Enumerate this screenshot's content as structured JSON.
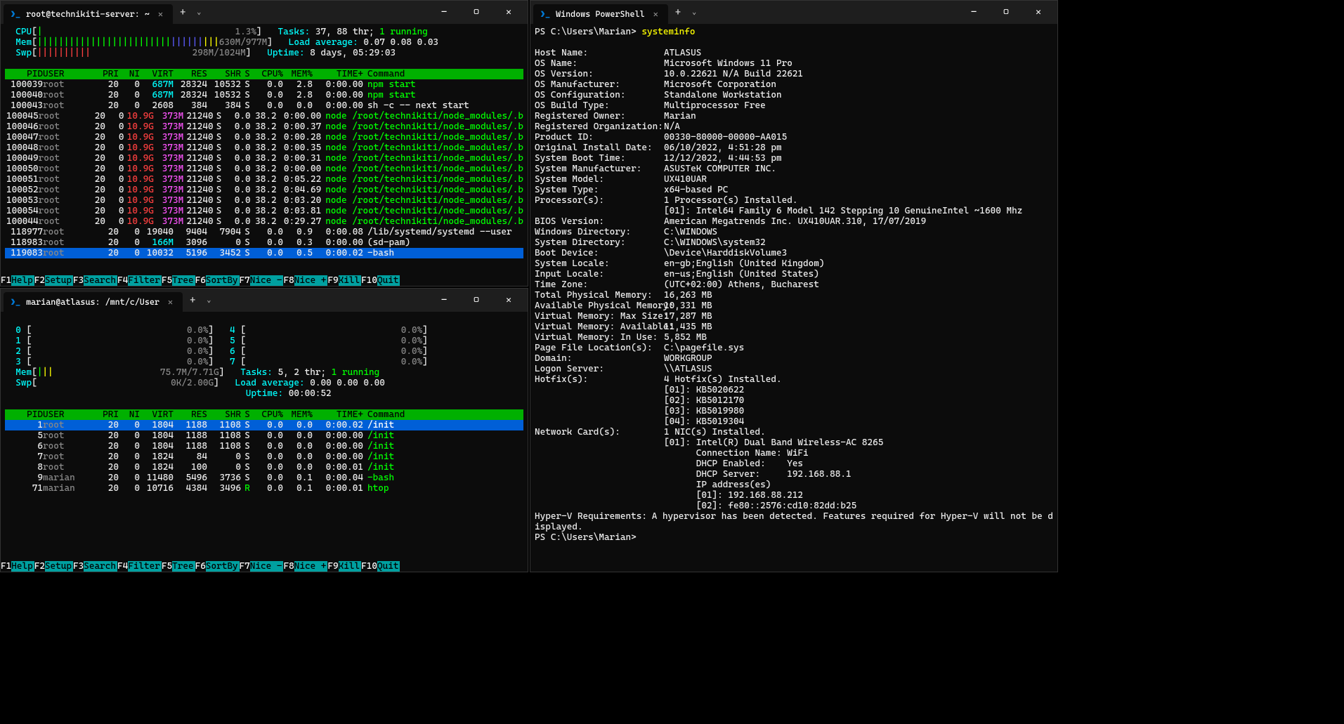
{
  "panes": {
    "topleft": {
      "title": "root@technikiti-server: ~"
    },
    "botleft": {
      "title": "marian@atlasus: /mnt/c/User"
    },
    "right": {
      "title": "Windows PowerShell"
    }
  },
  "htop1": {
    "cpu_pct": "1.3%",
    "mem_used": "630M",
    "mem_total": "977M",
    "swp_used": "298M",
    "swp_total": "1024M",
    "tasks": "37",
    "threads": "88",
    "running": "1",
    "load": "0.07 0.08 0.03",
    "uptime": "8 days, 05:29:03",
    "header": [
      "PID",
      "USER",
      "PRI",
      "NI",
      "VIRT",
      "RES",
      "SHR",
      "S",
      "CPU%",
      "MEM%",
      "TIME+",
      "Command"
    ],
    "rows": [
      {
        "pid": "100039",
        "user": "root",
        "pri": "20",
        "ni": "0",
        "virt": "687M",
        "res": "28324",
        "shr": "10532",
        "s": "S",
        "cpu": "0.0",
        "mem": "2.8",
        "time": "0:00.00",
        "cmd": "npm start",
        "vc": "cy",
        "cc": "gn"
      },
      {
        "pid": "100040",
        "user": "root",
        "pri": "20",
        "ni": "0",
        "virt": "687M",
        "res": "28324",
        "shr": "10532",
        "s": "S",
        "cpu": "0.0",
        "mem": "2.8",
        "time": "0:00.00",
        "cmd": "npm start",
        "vc": "cy",
        "cc": "gn"
      },
      {
        "pid": "100043",
        "user": "root",
        "pri": "20",
        "ni": "0",
        "virt": "2608",
        "res": "384",
        "shr": "384",
        "s": "S",
        "cpu": "0.0",
        "mem": "0.0",
        "time": "0:00.00",
        "cmd": "sh -c -- next start",
        "vc": "wh",
        "cc": "wh"
      },
      {
        "pid": "100045",
        "user": "root",
        "pri": "20",
        "ni": "0",
        "virt": "10.9G",
        "res": "373M",
        "shr": "21240",
        "s": "S",
        "cpu": "0.0",
        "mem": "38.2",
        "time": "0:00.00",
        "cmd": "node /root/technikiti/node_modules/.b",
        "vc": "rd",
        "rc": "mg",
        "cc": "gn"
      },
      {
        "pid": "100046",
        "user": "root",
        "pri": "20",
        "ni": "0",
        "virt": "10.9G",
        "res": "373M",
        "shr": "21240",
        "s": "S",
        "cpu": "0.0",
        "mem": "38.2",
        "time": "0:00.37",
        "cmd": "node /root/technikiti/node_modules/.b",
        "vc": "rd",
        "rc": "mg",
        "cc": "gn"
      },
      {
        "pid": "100047",
        "user": "root",
        "pri": "20",
        "ni": "0",
        "virt": "10.9G",
        "res": "373M",
        "shr": "21240",
        "s": "S",
        "cpu": "0.0",
        "mem": "38.2",
        "time": "0:00.28",
        "cmd": "node /root/technikiti/node_modules/.b",
        "vc": "rd",
        "rc": "mg",
        "cc": "gn"
      },
      {
        "pid": "100048",
        "user": "root",
        "pri": "20",
        "ni": "0",
        "virt": "10.9G",
        "res": "373M",
        "shr": "21240",
        "s": "S",
        "cpu": "0.0",
        "mem": "38.2",
        "time": "0:00.35",
        "cmd": "node /root/technikiti/node_modules/.b",
        "vc": "rd",
        "rc": "mg",
        "cc": "gn"
      },
      {
        "pid": "100049",
        "user": "root",
        "pri": "20",
        "ni": "0",
        "virt": "10.9G",
        "res": "373M",
        "shr": "21240",
        "s": "S",
        "cpu": "0.0",
        "mem": "38.2",
        "time": "0:00.31",
        "cmd": "node /root/technikiti/node_modules/.b",
        "vc": "rd",
        "rc": "mg",
        "cc": "gn"
      },
      {
        "pid": "100050",
        "user": "root",
        "pri": "20",
        "ni": "0",
        "virt": "10.9G",
        "res": "373M",
        "shr": "21240",
        "s": "S",
        "cpu": "0.0",
        "mem": "38.2",
        "time": "0:00.00",
        "cmd": "node /root/technikiti/node_modules/.b",
        "vc": "rd",
        "rc": "mg",
        "cc": "gn"
      },
      {
        "pid": "100051",
        "user": "root",
        "pri": "20",
        "ni": "0",
        "virt": "10.9G",
        "res": "373M",
        "shr": "21240",
        "s": "S",
        "cpu": "0.0",
        "mem": "38.2",
        "time": "0:05.22",
        "cmd": "node /root/technikiti/node_modules/.b",
        "vc": "rd",
        "rc": "mg",
        "cc": "gn"
      },
      {
        "pid": "100052",
        "user": "root",
        "pri": "20",
        "ni": "0",
        "virt": "10.9G",
        "res": "373M",
        "shr": "21240",
        "s": "S",
        "cpu": "0.0",
        "mem": "38.2",
        "time": "0:04.69",
        "cmd": "node /root/technikiti/node_modules/.b",
        "vc": "rd",
        "rc": "mg",
        "cc": "gn"
      },
      {
        "pid": "100053",
        "user": "root",
        "pri": "20",
        "ni": "0",
        "virt": "10.9G",
        "res": "373M",
        "shr": "21240",
        "s": "S",
        "cpu": "0.0",
        "mem": "38.2",
        "time": "0:03.20",
        "cmd": "node /root/technikiti/node_modules/.b",
        "vc": "rd",
        "rc": "mg",
        "cc": "gn"
      },
      {
        "pid": "100054",
        "user": "root",
        "pri": "20",
        "ni": "0",
        "virt": "10.9G",
        "res": "373M",
        "shr": "21240",
        "s": "S",
        "cpu": "0.0",
        "mem": "38.2",
        "time": "0:03.81",
        "cmd": "node /root/technikiti/node_modules/.b",
        "vc": "rd",
        "rc": "mg",
        "cc": "gn"
      },
      {
        "pid": "100044",
        "user": "root",
        "pri": "20",
        "ni": "0",
        "virt": "10.9G",
        "res": "373M",
        "shr": "21240",
        "s": "S",
        "cpu": "0.0",
        "mem": "38.2",
        "time": "0:29.27",
        "cmd": "node /root/technikiti/node_modules/.b",
        "vc": "rd",
        "rc": "mg",
        "cc": "gn"
      },
      {
        "pid": "118977",
        "user": "root",
        "pri": "20",
        "ni": "0",
        "virt": "19040",
        "res": "9404",
        "shr": "7904",
        "s": "S",
        "cpu": "0.0",
        "mem": "0.9",
        "time": "0:00.08",
        "cmd": "/lib/systemd/systemd --user",
        "vc": "wh",
        "cc": "wh"
      },
      {
        "pid": "118983",
        "user": "root",
        "pri": "20",
        "ni": "0",
        "virt": "166M",
        "res": "3096",
        "shr": "0",
        "s": "S",
        "cpu": "0.0",
        "mem": "0.3",
        "time": "0:00.00",
        "cmd": "(sd-pam)",
        "vc": "cy",
        "cc": "wh"
      },
      {
        "pid": "119083",
        "user": "root",
        "pri": "20",
        "ni": "0",
        "virt": "10032",
        "res": "5196",
        "shr": "3452",
        "s": "S",
        "cpu": "0.0",
        "mem": "0.5",
        "time": "0:00.02",
        "cmd": "-bash",
        "vc": "wh",
        "cc": "wh",
        "sel": true
      }
    ],
    "fkeys": [
      [
        "F1",
        "Help"
      ],
      [
        "F2",
        "Setup"
      ],
      [
        "F3",
        "Search"
      ],
      [
        "F4",
        "Filter"
      ],
      [
        "F5",
        "Tree"
      ],
      [
        "F6",
        "SortBy"
      ],
      [
        "F7",
        "Nice -"
      ],
      [
        "F8",
        "Nice +"
      ],
      [
        "F9",
        "Kill"
      ],
      [
        "F10",
        "Quit"
      ]
    ]
  },
  "htop2": {
    "cores": [
      {
        "n": "0",
        "pct": "0.0%"
      },
      {
        "n": "1",
        "pct": "0.0%"
      },
      {
        "n": "2",
        "pct": "0.0%"
      },
      {
        "n": "3",
        "pct": "0.0%"
      },
      {
        "n": "4",
        "pct": "0.0%"
      },
      {
        "n": "5",
        "pct": "0.0%"
      },
      {
        "n": "6",
        "pct": "0.0%"
      },
      {
        "n": "7",
        "pct": "0.0%"
      }
    ],
    "mem_used": "75.7M",
    "mem_total": "7.71G",
    "swp_used": "0K",
    "swp_total": "2.00G",
    "tasks": "5",
    "threads": "2",
    "running": "1",
    "load": "0.00 0.00 0.00",
    "uptime": "00:00:52",
    "rows": [
      {
        "pid": "1",
        "user": "root",
        "pri": "20",
        "ni": "0",
        "virt": "1804",
        "res": "1188",
        "shr": "1108",
        "s": "S",
        "cpu": "0.0",
        "mem": "0.0",
        "time": "0:00.02",
        "cmd": "/init",
        "sel": true
      },
      {
        "pid": "5",
        "user": "root",
        "pri": "20",
        "ni": "0",
        "virt": "1804",
        "res": "1188",
        "shr": "1108",
        "s": "S",
        "cpu": "0.0",
        "mem": "0.0",
        "time": "0:00.00",
        "cmd": "/init"
      },
      {
        "pid": "6",
        "user": "root",
        "pri": "20",
        "ni": "0",
        "virt": "1804",
        "res": "1188",
        "shr": "1108",
        "s": "S",
        "cpu": "0.0",
        "mem": "0.0",
        "time": "0:00.00",
        "cmd": "/init"
      },
      {
        "pid": "7",
        "user": "root",
        "pri": "20",
        "ni": "0",
        "virt": "1824",
        "res": "84",
        "shr": "0",
        "s": "S",
        "cpu": "0.0",
        "mem": "0.0",
        "time": "0:00.00",
        "cmd": "/init"
      },
      {
        "pid": "8",
        "user": "root",
        "pri": "20",
        "ni": "0",
        "virt": "1824",
        "res": "100",
        "shr": "0",
        "s": "S",
        "cpu": "0.0",
        "mem": "0.0",
        "time": "0:00.01",
        "cmd": "/init"
      },
      {
        "pid": "9",
        "user": "marian",
        "pri": "20",
        "ni": "0",
        "virt": "11480",
        "res": "5496",
        "shr": "3736",
        "s": "S",
        "cpu": "0.0",
        "mem": "0.1",
        "time": "0:00.04",
        "cmd": "-bash"
      },
      {
        "pid": "71",
        "user": "marian",
        "pri": "20",
        "ni": "0",
        "virt": "10716",
        "res": "4384",
        "shr": "3496",
        "s": "R",
        "cpu": "0.0",
        "mem": "0.1",
        "time": "0:00.01",
        "cmd": "htop"
      }
    ]
  },
  "ps": {
    "prompt": "PS C:\\Users\\Marian>",
    "cmd": "systeminfo",
    "lines": [
      [
        "Host Name:",
        "ATLASUS"
      ],
      [
        "OS Name:",
        "Microsoft Windows 11 Pro"
      ],
      [
        "OS Version:",
        "10.0.22621 N/A Build 22621"
      ],
      [
        "OS Manufacturer:",
        "Microsoft Corporation"
      ],
      [
        "OS Configuration:",
        "Standalone Workstation"
      ],
      [
        "OS Build Type:",
        "Multiprocessor Free"
      ],
      [
        "Registered Owner:",
        "Marian"
      ],
      [
        "Registered Organization:",
        "N/A"
      ],
      [
        "Product ID:",
        "00330-80000-00000-AA015"
      ],
      [
        "Original Install Date:",
        "06/10/2022, 4:51:28 pm"
      ],
      [
        "System Boot Time:",
        "12/12/2022, 4:44:53 pm"
      ],
      [
        "System Manufacturer:",
        "ASUSTeK COMPUTER INC."
      ],
      [
        "System Model:",
        "UX410UAR"
      ],
      [
        "System Type:",
        "x64-based PC"
      ],
      [
        "Processor(s):",
        "1 Processor(s) Installed."
      ],
      [
        "",
        "[01]: Intel64 Family 6 Model 142 Stepping 10 GenuineIntel ~1600 Mhz"
      ],
      [
        "BIOS Version:",
        "American Megatrends Inc. UX410UAR.310, 17/07/2019"
      ],
      [
        "Windows Directory:",
        "C:\\WINDOWS"
      ],
      [
        "System Directory:",
        "C:\\WINDOWS\\system32"
      ],
      [
        "Boot Device:",
        "\\Device\\HarddiskVolume3"
      ],
      [
        "System Locale:",
        "en-gb;English (United Kingdom)"
      ],
      [
        "Input Locale:",
        "en-us;English (United States)"
      ],
      [
        "Time Zone:",
        "(UTC+02:00) Athens, Bucharest"
      ],
      [
        "Total Physical Memory:",
        "16,263 MB"
      ],
      [
        "Available Physical Memory:",
        "10,331 MB"
      ],
      [
        "Virtual Memory: Max Size:",
        "17,287 MB"
      ],
      [
        "Virtual Memory: Available:",
        "11,435 MB"
      ],
      [
        "Virtual Memory: In Use:",
        "5,852 MB"
      ],
      [
        "Page File Location(s):",
        "C:\\pagefile.sys"
      ],
      [
        "Domain:",
        "WORKGROUP"
      ],
      [
        "Logon Server:",
        "\\\\ATLASUS"
      ],
      [
        "Hotfix(s):",
        "4 Hotfix(s) Installed."
      ],
      [
        "",
        "[01]: KB5020622"
      ],
      [
        "",
        "[02]: KB5012170"
      ],
      [
        "",
        "[03]: KB5019980"
      ],
      [
        "",
        "[04]: KB5019304"
      ],
      [
        "Network Card(s):",
        "1 NIC(s) Installed."
      ],
      [
        "",
        "[01]: Intel(R) Dual Band Wireless-AC 8265"
      ],
      [
        "",
        "      Connection Name: WiFi"
      ],
      [
        "",
        "      DHCP Enabled:    Yes"
      ],
      [
        "",
        "      DHCP Server:     192.168.88.1"
      ],
      [
        "",
        "      IP address(es)"
      ],
      [
        "",
        "      [01]: 192.168.88.212"
      ],
      [
        "",
        "      [02]: fe80::2576:cd10:82dd:b25"
      ],
      [
        "Hyper-V Requirements:",
        "A hypervisor has been detected. Features required for Hyper-V will not be d"
      ],
      [
        "isplayed.",
        ""
      ]
    ]
  }
}
